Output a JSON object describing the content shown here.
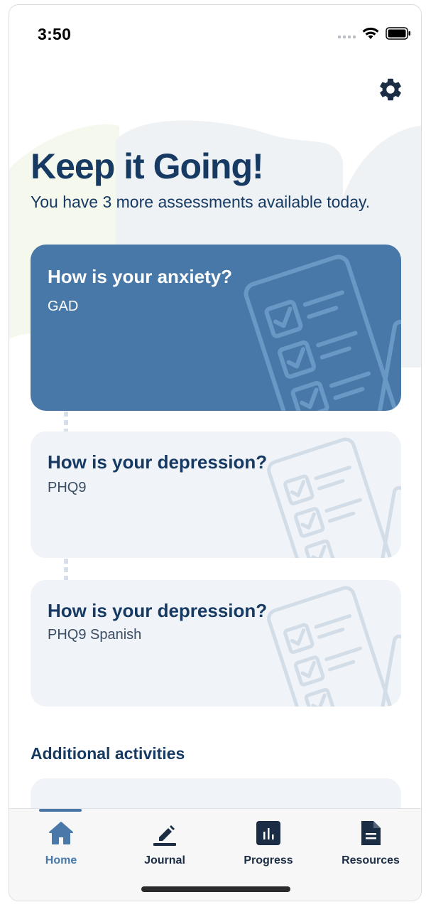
{
  "status_bar": {
    "time": "3:50"
  },
  "header": {
    "title": "Keep it Going!",
    "subtitle": "You have 3 more assessments available today."
  },
  "assessments": [
    {
      "title": "How is your anxiety?",
      "subtitle": "GAD",
      "state": "active"
    },
    {
      "title": "How is your depression?",
      "subtitle": "PHQ9",
      "state": "inactive"
    },
    {
      "title": "How is your depression?",
      "subtitle": "PHQ9 Spanish",
      "state": "inactive"
    }
  ],
  "additional": {
    "title": "Additional activities"
  },
  "tabs": [
    {
      "label": "Home",
      "icon": "home-icon",
      "selected": true
    },
    {
      "label": "Journal",
      "icon": "pencil-icon",
      "selected": false
    },
    {
      "label": "Progress",
      "icon": "chart-icon",
      "selected": false
    },
    {
      "label": "Resources",
      "icon": "document-icon",
      "selected": false
    }
  ],
  "colors": {
    "primary": "#4878a8",
    "heading": "#173a63",
    "card_inactive": "#f0f3f7",
    "tab_selected": "#4a78a8"
  }
}
